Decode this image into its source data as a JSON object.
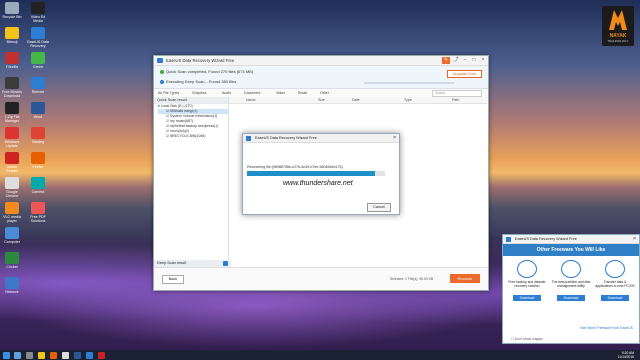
{
  "desktop_icons": [
    {
      "label": "Recycle Bin",
      "color": "#9ab"
    },
    {
      "label": "Bitmoji",
      "color": "#f3c318"
    },
    {
      "label": "Filezilla",
      "color": "#c03030"
    },
    {
      "label": "Free Movies Download",
      "color": "#3b3b3b"
    },
    {
      "label": "7-Zip File Manager",
      "color": "#222"
    },
    {
      "label": "Windows Update",
      "color": "#d33"
    },
    {
      "label": "Adobe Reader",
      "color": "#c22"
    },
    {
      "label": "Google Chrome",
      "color": "#ddd"
    },
    {
      "label": "VLC media player",
      "color": "#f08a1c"
    },
    {
      "label": "Computer",
      "color": "#4a8bd6"
    },
    {
      "label": "Cricket",
      "color": "#2b8a3e"
    },
    {
      "label": "Network",
      "color": "#3c78c8"
    },
    {
      "label": "Video Ed Media",
      "color": "#222"
    },
    {
      "label": "EaseUS Data Recovery",
      "color": "#2d7dd2"
    },
    {
      "label": "Green",
      "color": "#47b64a"
    },
    {
      "label": "Remote",
      "color": "#2d7dd2"
    },
    {
      "label": "Word",
      "color": "#2b5797"
    },
    {
      "label": "Gaming",
      "color": "#d43"
    },
    {
      "label": "Firefox",
      "color": "#e66000"
    },
    {
      "label": "Camera",
      "color": "#0aa"
    },
    {
      "label": "Free PDF Solutions",
      "color": "#e55"
    }
  ],
  "logo": {
    "text": "NAYAK",
    "sub": "TECHNOLOGY"
  },
  "window": {
    "title": "EaseUS Data Recovery Wizard Free",
    "status_line1": "Quick Scan completed. Found 270 files (674 MB)",
    "status_line2": "Executing Deep Scan... Found 380 files",
    "upgrade_label": "Upgrade Now",
    "filters": {
      "type": "All File Types",
      "graphics": "Graphics",
      "audio": "Audio",
      "document": "Document",
      "video": "Video",
      "email": "Email",
      "other": "Other"
    },
    "search_placeholder": "Search",
    "left_header": "Quick Scan result",
    "tree": [
      "Local Disk (E:) (270)",
      "MSBuild Integr(1)",
      "System Volume Information(1)",
      "my music(687)",
      "wpSetbat backup wordpress(1)",
      "micro(sd)(2)",
      "$RECYCLE.BIN(1046)"
    ],
    "deep_scan_label": "Deep Scan result",
    "columns": {
      "name": "Name",
      "size": "Size",
      "date": "Date",
      "type": "Type",
      "path": "Path"
    },
    "back_label": "Back",
    "selected": "Selected: 2 File(s), 96.00 KB",
    "recover_label": "Recover"
  },
  "dialog": {
    "title": "EaseUS Data Recovery Wizard Free",
    "message": "Recovering file:{96988756e-c276-4e49-b7ee-960464eb175}",
    "progress": 0.93,
    "watermark": "www.thundershare.net",
    "cancel_label": "Cancel"
  },
  "ad": {
    "title": "EaseUS Data Recovery Wizard Free",
    "banner": "Other Freeware You Will Like",
    "cards": [
      {
        "text": "Free backup and disaster recovery solution",
        "button": "Download"
      },
      {
        "text": "The best partition and disk management utility",
        "button": "Download"
      },
      {
        "text": "Transfer data & applications to new PC/OS",
        "button": "Download"
      }
    ],
    "more": "See More Freeware from EaseUS",
    "checkbox": "Don't show it again"
  },
  "clock": {
    "time": "9:20 AM",
    "date": "11/14/2016"
  }
}
